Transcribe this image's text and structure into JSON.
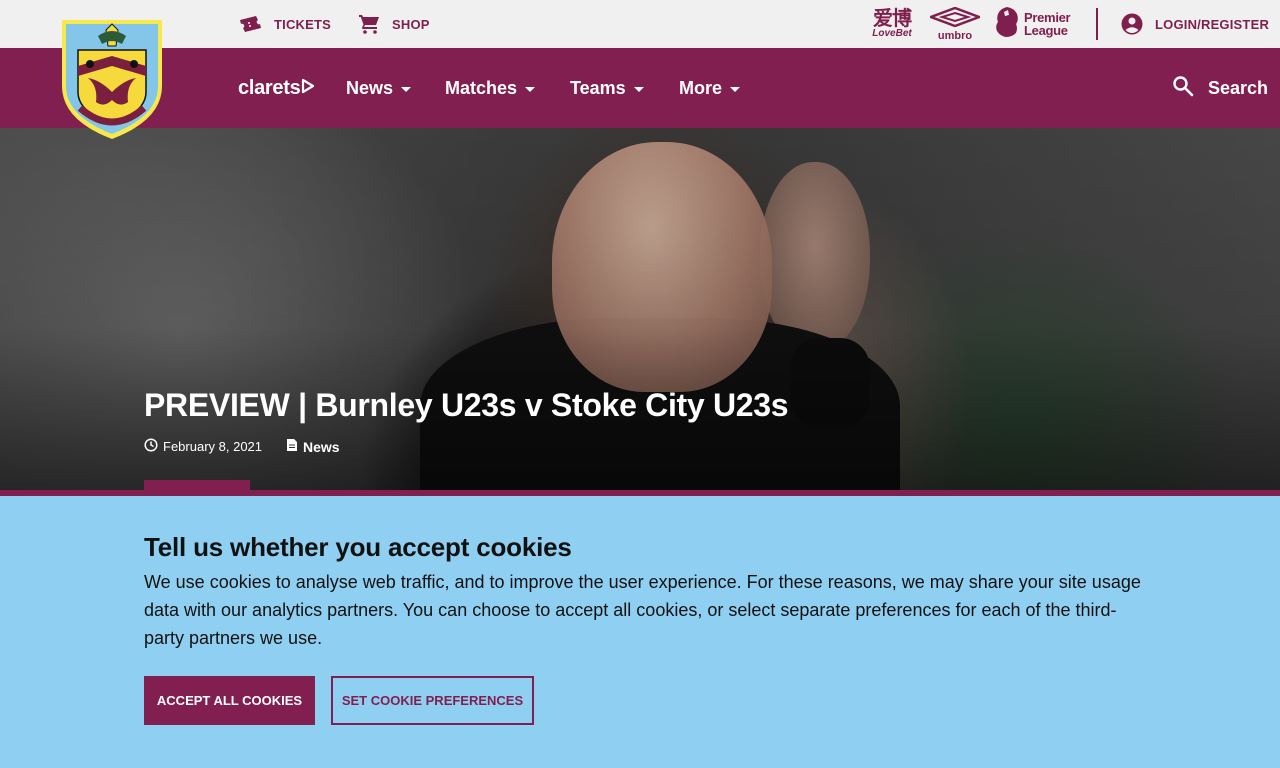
{
  "topbar": {
    "tickets_label": "TICKETS",
    "shop_label": "SHOP",
    "login_label": "LOGIN/REGISTER",
    "sponsors": {
      "lovebet_cn": "爱博",
      "lovebet_en": "LoveBet",
      "umbro": "umbro",
      "pl_line1": "Premier",
      "pl_line2": "League"
    }
  },
  "nav": {
    "brand": "clarets",
    "items": [
      {
        "label": "News"
      },
      {
        "label": "Matches"
      },
      {
        "label": "Teams"
      },
      {
        "label": "More"
      }
    ],
    "search_label": "Search"
  },
  "hero": {
    "title": "PREVIEW | Burnley U23s v Stoke City U23s",
    "date": "February 8, 2021",
    "category": "News"
  },
  "cookie": {
    "title": "Tell us whether you accept cookies",
    "text": "We use cookies to analyse web traffic, and to improve the user experience. For these reasons, we may share your site usage data with our analytics partners. You can choose to accept all cookies, or select separate preferences for each of the third-party partners we use.",
    "accept_label": "ACCEPT ALL COOKIES",
    "prefs_label": "SET COOKIE PREFERENCES"
  },
  "colors": {
    "claret": "#812050",
    "cookie_bg": "#8fd0f2",
    "topbar_bg": "#f0f0f0"
  }
}
